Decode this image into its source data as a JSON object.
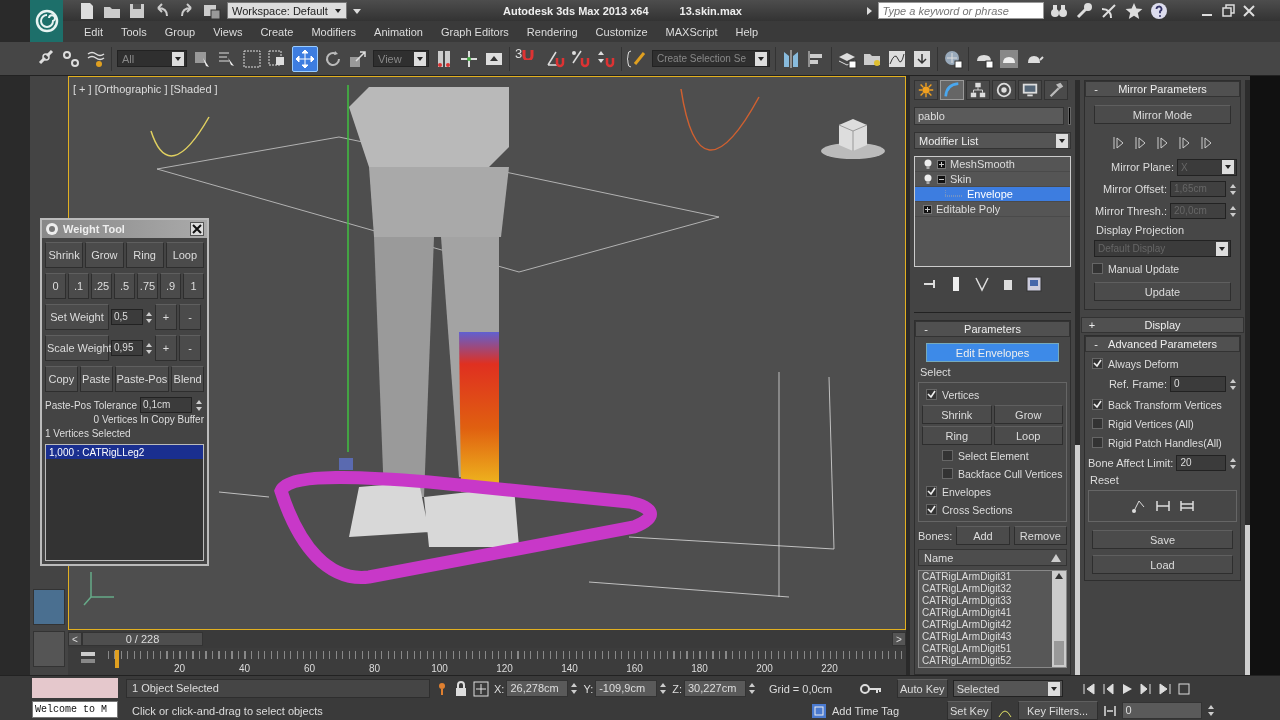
{
  "title_bar": {
    "workspace": "Workspace: Default",
    "app_title": "Autodesk 3ds Max  2013 x64",
    "file_name": "13.skin.max",
    "search_placeholder": "Type a keyword or phrase"
  },
  "menu": [
    "Edit",
    "Tools",
    "Group",
    "Views",
    "Create",
    "Modifiers",
    "Animation",
    "Graph Editors",
    "Rendering",
    "Customize",
    "MAXScript",
    "Help"
  ],
  "toolbar": {
    "selection_filter": "All",
    "reference_coordinate": "View",
    "snap_toggle": "3",
    "named_selection": "Create Selection Se",
    "move_tool": {
      "selected": true
    }
  },
  "viewport": {
    "label": "[ + ] [Orthographic ] [Shaded ]"
  },
  "weight_tool": {
    "title": "Weight Tool",
    "select_buttons": [
      "Shrink",
      "Grow",
      "Ring",
      "Loop"
    ],
    "weight_presets": [
      "0",
      ".1",
      ".25",
      ".5",
      ".75",
      ".9",
      "1"
    ],
    "set_weight": {
      "label": "Set Weight",
      "value": "0,5",
      "plus": "+",
      "minus": "-"
    },
    "scale_weight": {
      "label": "Scale Weight",
      "value": "0,95",
      "plus": "+",
      "minus": "-"
    },
    "copy_buttons": [
      "Copy",
      "Paste",
      "Paste-Pos",
      "Blend"
    ],
    "tolerance": {
      "label": "Paste-Pos Tolerance",
      "value": "0,1cm"
    },
    "buffer_status": "0 Vertices In Copy Buffer",
    "selection_status": "1 Vertices Selected",
    "weights": [
      {
        "text": "1,000 : CATRigLLeg2",
        "selected": true
      }
    ]
  },
  "command_panel": {
    "tabs": [
      {
        "kind": "create",
        "selected": false
      },
      {
        "kind": "modify",
        "selected": true
      },
      {
        "kind": "hierarchy",
        "selected": false
      },
      {
        "kind": "motion",
        "selected": false
      },
      {
        "kind": "display",
        "selected": false
      },
      {
        "kind": "utilities",
        "selected": false
      }
    ],
    "object_name": "pablo",
    "modifier_list": "Modifier List",
    "stack": [
      {
        "name": "MeshSmooth",
        "kind": "modifier",
        "expanded": false,
        "selected": false
      },
      {
        "name": "Skin",
        "kind": "modifier",
        "expanded": true,
        "selected": false,
        "children": [
          {
            "name": "Envelope",
            "kind": "subobject",
            "selected": true
          }
        ]
      },
      {
        "name": "Editable Poly",
        "kind": "base",
        "expanded": false,
        "selected": false
      }
    ],
    "parameters": {
      "toggle": "-",
      "title": "Parameters",
      "edit_envelopes": {
        "label": "Edit Envelopes",
        "selected": true
      },
      "select_group": "Select",
      "vertices": {
        "label": "Vertices",
        "checked": true
      },
      "select_buttons": [
        "Shrink",
        "Grow",
        "Ring",
        "Loop"
      ],
      "select_element": {
        "label": "Select Element",
        "checked": false
      },
      "backface_cull": {
        "label": "Backface Cull Vertices",
        "checked": false
      },
      "envelopes": {
        "label": "Envelopes",
        "checked": true
      },
      "cross_sections": {
        "label": "Cross Sections",
        "checked": true
      },
      "bones_label": "Bones:",
      "add": "Add",
      "remove": "Remove",
      "list_header": "Name",
      "bones": [
        "CATRigLArmDigit31",
        "CATRigLArmDigit32",
        "CATRigLArmDigit33",
        "CATRigLArmDigit41",
        "CATRigLArmDigit42",
        "CATRigLArmDigit43",
        "CATRigLArmDigit51",
        "CATRigLArmDigit52"
      ]
    },
    "mirror_parameters": {
      "toggle": "-",
      "title": "Mirror Parameters",
      "mirror_mode": "Mirror Mode",
      "mirror_plane": {
        "label": "Mirror Plane:",
        "value": "X",
        "disabled": true
      },
      "mirror_offset": {
        "label": "Mirror Offset:",
        "value": "1,65cm",
        "disabled": true
      },
      "mirror_threshold": {
        "label": "Mirror Thresh.:",
        "value": "20,0cm",
        "disabled": true
      },
      "display_projection": {
        "label": "Display Projection",
        "value": "Default Display",
        "disabled": true
      },
      "manual_update": {
        "label": "Manual Update",
        "checked": false
      },
      "update": "Update"
    },
    "display": {
      "toggle": "+",
      "title": "Display"
    },
    "advanced_parameters": {
      "toggle": "-",
      "title": "Advanced Parameters",
      "always_deform": {
        "label": "Always Deform",
        "checked": true
      },
      "ref_frame": {
        "label": "Ref. Frame:",
        "value": "0"
      },
      "back_transform": {
        "label": "Back Transform Vertices",
        "checked": true
      },
      "rigid_vertices": {
        "label": "Rigid Vertices (All)",
        "checked": false
      },
      "rigid_patch": {
        "label": "Rigid Patch Handles(All)",
        "checked": false
      },
      "bone_affect_limit": {
        "label": "Bone Affect Limit:",
        "value": "20"
      },
      "reset_group": "Reset",
      "save": "Save",
      "load": "Load"
    }
  },
  "time_slider": {
    "prev": "<",
    "position": "0 / 228",
    "next": ">"
  },
  "track_bar": {
    "ticks": [
      "20",
      "40",
      "60",
      "80",
      "100",
      "120",
      "140",
      "160",
      "180",
      "200",
      "220"
    ]
  },
  "status_bar": {
    "listener": "Welcome to M",
    "selection": "1 Object Selected",
    "prompt": "Click or click-and-drag to select objects",
    "x": {
      "label": "X:",
      "value": "26,278cm"
    },
    "y": {
      "label": "Y:",
      "value": "-109,9cm"
    },
    "z": {
      "label": "Z:",
      "value": "30,227cm"
    },
    "grid": "Grid = 0,0cm",
    "add_time_tag": "Add Time Tag",
    "auto_key": "Auto Key",
    "key_mode": "Selected",
    "set_key": "Set Key",
    "key_filters": "Key Filters...",
    "frame": "0"
  }
}
